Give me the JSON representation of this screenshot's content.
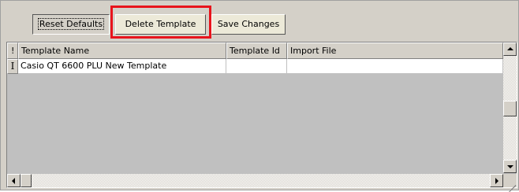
{
  "toolbar": {
    "reset_defaults": "Reset Defaults",
    "delete_template": "Delete Template",
    "save_changes": "Save Changes"
  },
  "grid": {
    "columns": [
      "!",
      "Template Name",
      "Template Id",
      "Import File"
    ],
    "rows": [
      {
        "indicator": "I",
        "template_name": "Casio QT 6600 PLU New Template",
        "template_id": "",
        "import_file": ""
      }
    ]
  },
  "colors": {
    "highlight": "#e8141c",
    "face": "#d4d0c8"
  },
  "icons": [
    "scroll-up-arrow-icon",
    "scroll-down-arrow-icon",
    "scroll-left-arrow-icon",
    "scroll-right-arrow-icon",
    "size-grip-icon",
    "text-cursor-icon"
  ]
}
